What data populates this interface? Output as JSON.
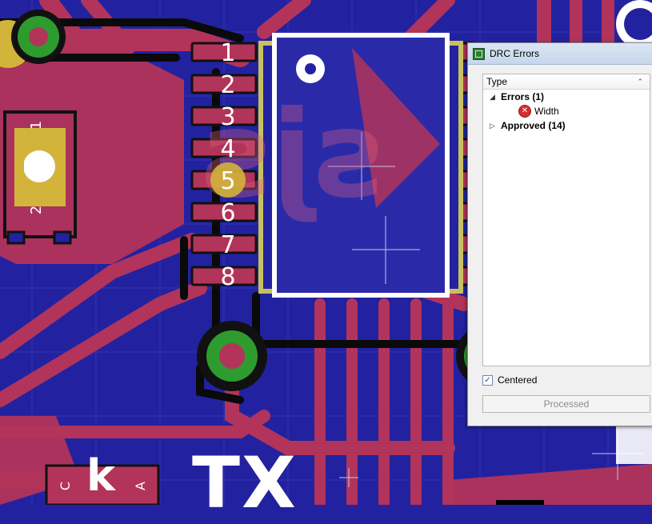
{
  "pcb": {
    "pin_labels": [
      "1",
      "2",
      "3",
      "4",
      "5",
      "6",
      "7",
      "8"
    ],
    "silk_tx": "TX",
    "silk_c": "C",
    "silk_k": "k",
    "silk_a": "A",
    "silk_1": "1",
    "silk_2": "2",
    "watermark": "sjs"
  },
  "drc": {
    "title": "DRC Errors",
    "column_header": "Type",
    "tree": {
      "errors_label": "Errors (1)",
      "error_item": "Width",
      "approved_label": "Approved (14)"
    },
    "centered_label": "Centered",
    "centered_checked": true,
    "processed_button": "Processed"
  },
  "colors": {
    "board_bg": "#2222a0",
    "copper_top": "#c03a52",
    "pad": "#d2b43a",
    "via": "#2e9b2e",
    "silkscreen": "#ffffff",
    "outline": "#c8c060"
  }
}
